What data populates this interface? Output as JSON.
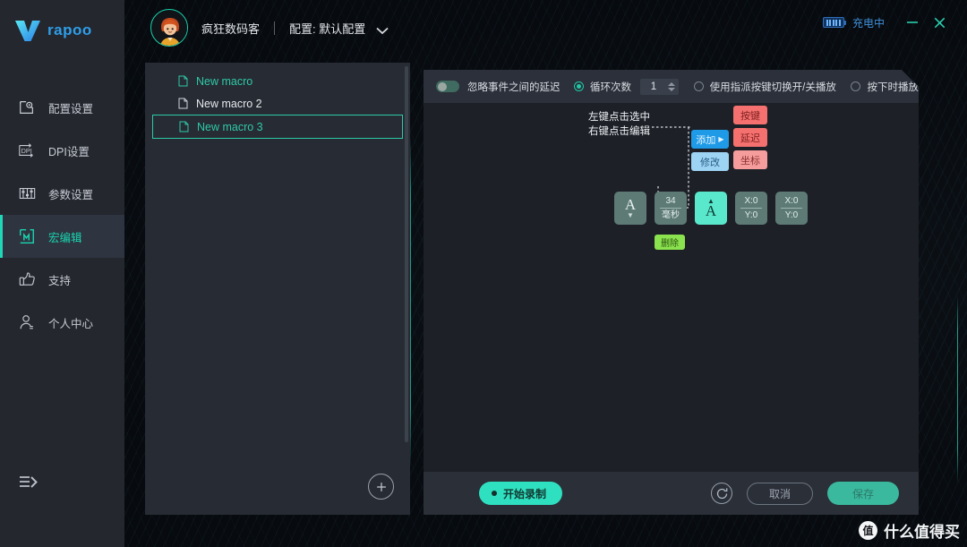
{
  "brand": {
    "name": "rapoo",
    "logo_icon": "rapoo-v-logo"
  },
  "sidebar": {
    "items": [
      {
        "label": "配置设置",
        "icon": "config-icon"
      },
      {
        "label": "DPI设置",
        "icon": "dpi-icon"
      },
      {
        "label": "参数设置",
        "icon": "sliders-icon"
      },
      {
        "label": "宏编辑",
        "icon": "macro-m-icon"
      },
      {
        "label": "支持",
        "icon": "thumbs-up-icon"
      },
      {
        "label": "个人中心",
        "icon": "user-icon"
      }
    ],
    "active_index": 3,
    "collapse_icon": "collapse-arrow-icon"
  },
  "topbar": {
    "user_name": "疯狂数码客",
    "separator": "|",
    "profile_label": "配置: 默认配置",
    "profile_chevron_icon": "chevron-down-icon",
    "battery_icon": "battery-charging-icon",
    "battery_text": "充电中",
    "minimize_icon": "minimize-icon",
    "close_icon": "close-icon",
    "accent": "#19d6b0"
  },
  "macro_list": {
    "items": [
      {
        "label": "New macro",
        "icon": "file-icon",
        "state": "accent"
      },
      {
        "label": "New macro 2",
        "icon": "file-icon",
        "state": "normal"
      },
      {
        "label": "New macro 3",
        "icon": "file-icon",
        "state": "selected"
      }
    ],
    "add_button_icon": "plus-circle-icon"
  },
  "options_bar": {
    "ignore_delay": {
      "label": "忽略事件之间的延迟",
      "toggle_on": false
    },
    "loop_count": {
      "label": "循环次数",
      "selected": true,
      "value": "1"
    },
    "toggle_playback": {
      "label": "使用指派按键切换开/关播放",
      "selected": false
    },
    "play_on_press": {
      "label": "按下时播放",
      "selected": false
    }
  },
  "canvas": {
    "hint_line1": "左键点击选中",
    "hint_line2": "右键点击编辑",
    "context_menu": [
      {
        "label": "添加",
        "arrow": "▶",
        "kind": "add"
      },
      {
        "label": "修改",
        "arrow": "",
        "kind": "mod"
      }
    ],
    "sub_menu": [
      {
        "label": "按键",
        "hot": true
      },
      {
        "label": "延迟",
        "hot": true
      },
      {
        "label": "坐标",
        "hot": false
      }
    ],
    "blocks": [
      {
        "type": "key",
        "glyph": "A",
        "caret": "▼",
        "caret_pos": "bottom",
        "selected": false
      },
      {
        "type": "delay",
        "line1": "34",
        "line2": "毫秒",
        "selected": false
      },
      {
        "type": "key",
        "glyph": "A",
        "caret": "▲",
        "caret_pos": "top",
        "selected": true
      },
      {
        "type": "coord",
        "line1": "X:0",
        "line2": "Y:0",
        "selected": false
      },
      {
        "type": "coord",
        "line1": "X:0",
        "line2": "Y:0",
        "selected": false
      }
    ],
    "delete_tag": "删除"
  },
  "footer": {
    "record_label": "开始录制",
    "refresh_icon": "refresh-icon",
    "cancel_label": "取消",
    "save_label": "保存"
  },
  "watermark": {
    "logo": "值",
    "text": "什么值得买"
  }
}
